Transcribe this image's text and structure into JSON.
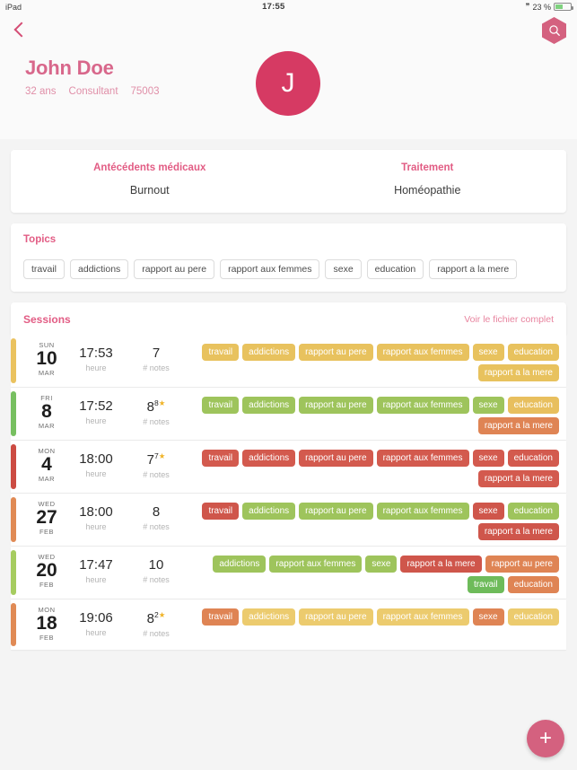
{
  "status_bar": {
    "device": "iPad",
    "time": "17:55",
    "bluetooth_icon": "bluetooth-icon",
    "battery_percent": "23 %"
  },
  "nav": {
    "back_icon": "chevron-left-icon",
    "search_icon": "search-icon"
  },
  "profile": {
    "name": "John Doe",
    "age": "32 ans",
    "job": "Consultant",
    "postal_code": "75003",
    "avatar_initial": "J"
  },
  "medical": {
    "history_title": "Antécédents médicaux",
    "history_value": "Burnout",
    "treatment_title": "Traitement",
    "treatment_value": "Homéopathie"
  },
  "topics": {
    "title": "Topics",
    "items": [
      "travail",
      "addictions",
      "rapport au pere",
      "rapport aux femmes",
      "sexe",
      "education",
      "rapport a la mere"
    ]
  },
  "sessions": {
    "title": "Sessions",
    "link": "Voir le fichier complet",
    "labels": {
      "time": "heure",
      "notes": "# notes"
    },
    "rows": [
      {
        "bar_color": "#eac25f",
        "dow": "SUN",
        "day": "10",
        "month": "MAR",
        "time": "17:53",
        "notes": "7",
        "notes_sup": "",
        "notes_star": false,
        "tags": [
          {
            "label": "travail",
            "color": "#e8c25e"
          },
          {
            "label": "addictions",
            "color": "#e8c25e"
          },
          {
            "label": "rapport au pere",
            "color": "#e8c25e"
          },
          {
            "label": "rapport aux femmes",
            "color": "#e8c25e"
          },
          {
            "label": "sexe",
            "color": "#e8c25e"
          },
          {
            "label": "education",
            "color": "#e8c25e"
          },
          {
            "label": "rapport a la mere",
            "color": "#e8c25e"
          }
        ]
      },
      {
        "bar_color": "#77bf60",
        "dow": "FRI",
        "day": "8",
        "month": "MAR",
        "time": "17:52",
        "notes": "8",
        "notes_sup": "8",
        "notes_star": true,
        "tags": [
          {
            "label": "travail",
            "color": "#9ec45c"
          },
          {
            "label": "addictions",
            "color": "#9ec45c"
          },
          {
            "label": "rapport au pere",
            "color": "#9ec45c"
          },
          {
            "label": "rapport aux femmes",
            "color": "#9ec45c"
          },
          {
            "label": "sexe",
            "color": "#9ec45c"
          },
          {
            "label": "education",
            "color": "#e8bf5e"
          },
          {
            "label": "rapport a la mere",
            "color": "#df8454"
          }
        ]
      },
      {
        "bar_color": "#cc4b42",
        "dow": "MON",
        "day": "4",
        "month": "MAR",
        "time": "18:00",
        "notes": "7",
        "notes_sup": "7",
        "notes_star": true,
        "tags": [
          {
            "label": "travail",
            "color": "#d35a4e"
          },
          {
            "label": "addictions",
            "color": "#d35a4e"
          },
          {
            "label": "rapport au pere",
            "color": "#d35a4e"
          },
          {
            "label": "rapport aux femmes",
            "color": "#d35a4e"
          },
          {
            "label": "sexe",
            "color": "#d35a4e"
          },
          {
            "label": "education",
            "color": "#d35a4e"
          },
          {
            "label": "rapport a la mere",
            "color": "#d35a4e"
          }
        ]
      },
      {
        "bar_color": "#e08a55",
        "dow": "WED",
        "day": "27",
        "month": "FEB",
        "time": "18:00",
        "notes": "8",
        "notes_sup": "",
        "notes_star": false,
        "tags": [
          {
            "label": "travail",
            "color": "#cf564b"
          },
          {
            "label": "addictions",
            "color": "#9ec45c"
          },
          {
            "label": "rapport au pere",
            "color": "#9ec45c"
          },
          {
            "label": "rapport aux femmes",
            "color": "#9ec45c"
          },
          {
            "label": "sexe",
            "color": "#cf564b"
          },
          {
            "label": "education",
            "color": "#9ec45c"
          },
          {
            "label": "rapport a la mere",
            "color": "#cf564b"
          }
        ]
      },
      {
        "bar_color": "#a6cc60",
        "dow": "WED",
        "day": "20",
        "month": "FEB",
        "time": "17:47",
        "notes": "10",
        "notes_sup": "",
        "notes_star": false,
        "tags": [
          {
            "label": "addictions",
            "color": "#9ec45c"
          },
          {
            "label": "rapport aux femmes",
            "color": "#9ec45c"
          },
          {
            "label": "sexe",
            "color": "#9ec45c"
          },
          {
            "label": "rapport a la mere",
            "color": "#cf564b"
          },
          {
            "label": "rapport au pere",
            "color": "#df8454"
          },
          {
            "label": "travail",
            "color": "#6ebb5a"
          },
          {
            "label": "education",
            "color": "#df8454"
          }
        ]
      },
      {
        "bar_color": "#e08a55",
        "dow": "MON",
        "day": "18",
        "month": "FEB",
        "time": "19:06",
        "notes": "8",
        "notes_sup": "2",
        "notes_star": true,
        "tags": [
          {
            "label": "travail",
            "color": "#df8454"
          },
          {
            "label": "addictions",
            "color": "#eccb6e"
          },
          {
            "label": "rapport au pere",
            "color": "#eccb6e"
          },
          {
            "label": "rapport aux femmes",
            "color": "#eccb6e"
          },
          {
            "label": "sexe",
            "color": "#df8454"
          },
          {
            "label": "education",
            "color": "#eccb6e"
          }
        ]
      }
    ]
  },
  "fab": {
    "label": "+",
    "icon": "plus-icon"
  },
  "colors": {
    "accent_pink": "#d4617f",
    "title_pink": "#e25c84",
    "name_pink": "#d8678b"
  }
}
